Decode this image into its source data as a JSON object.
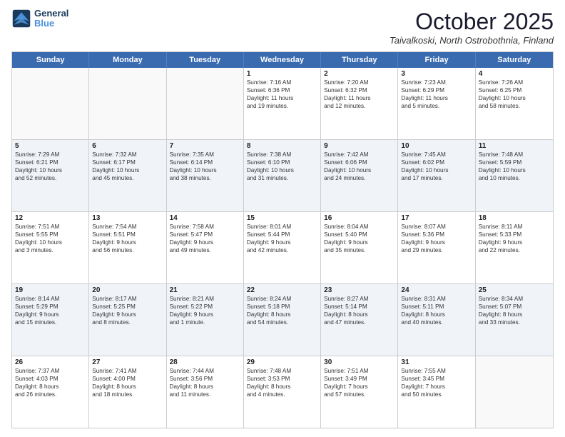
{
  "header": {
    "logo_line1": "General",
    "logo_line2": "Blue",
    "month": "October 2025",
    "location": "Taivalkoski, North Ostrobothnia, Finland"
  },
  "weekdays": [
    "Sunday",
    "Monday",
    "Tuesday",
    "Wednesday",
    "Thursday",
    "Friday",
    "Saturday"
  ],
  "rows": [
    [
      {
        "day": "",
        "info": "",
        "empty": true
      },
      {
        "day": "",
        "info": "",
        "empty": true
      },
      {
        "day": "",
        "info": "",
        "empty": true
      },
      {
        "day": "1",
        "info": "Sunrise: 7:16 AM\nSunset: 6:36 PM\nDaylight: 11 hours\nand 19 minutes.",
        "alt": false
      },
      {
        "day": "2",
        "info": "Sunrise: 7:20 AM\nSunset: 6:32 PM\nDaylight: 11 hours\nand 12 minutes.",
        "alt": false
      },
      {
        "day": "3",
        "info": "Sunrise: 7:23 AM\nSunset: 6:29 PM\nDaylight: 11 hours\nand 5 minutes.",
        "alt": false
      },
      {
        "day": "4",
        "info": "Sunrise: 7:26 AM\nSunset: 6:25 PM\nDaylight: 10 hours\nand 58 minutes.",
        "alt": false
      }
    ],
    [
      {
        "day": "5",
        "info": "Sunrise: 7:29 AM\nSunset: 6:21 PM\nDaylight: 10 hours\nand 52 minutes.",
        "alt": true
      },
      {
        "day": "6",
        "info": "Sunrise: 7:32 AM\nSunset: 6:17 PM\nDaylight: 10 hours\nand 45 minutes.",
        "alt": true
      },
      {
        "day": "7",
        "info": "Sunrise: 7:35 AM\nSunset: 6:14 PM\nDaylight: 10 hours\nand 38 minutes.",
        "alt": true
      },
      {
        "day": "8",
        "info": "Sunrise: 7:38 AM\nSunset: 6:10 PM\nDaylight: 10 hours\nand 31 minutes.",
        "alt": true
      },
      {
        "day": "9",
        "info": "Sunrise: 7:42 AM\nSunset: 6:06 PM\nDaylight: 10 hours\nand 24 minutes.",
        "alt": true
      },
      {
        "day": "10",
        "info": "Sunrise: 7:45 AM\nSunset: 6:02 PM\nDaylight: 10 hours\nand 17 minutes.",
        "alt": true
      },
      {
        "day": "11",
        "info": "Sunrise: 7:48 AM\nSunset: 5:59 PM\nDaylight: 10 hours\nand 10 minutes.",
        "alt": true
      }
    ],
    [
      {
        "day": "12",
        "info": "Sunrise: 7:51 AM\nSunset: 5:55 PM\nDaylight: 10 hours\nand 3 minutes.",
        "alt": false
      },
      {
        "day": "13",
        "info": "Sunrise: 7:54 AM\nSunset: 5:51 PM\nDaylight: 9 hours\nand 56 minutes.",
        "alt": false
      },
      {
        "day": "14",
        "info": "Sunrise: 7:58 AM\nSunset: 5:47 PM\nDaylight: 9 hours\nand 49 minutes.",
        "alt": false
      },
      {
        "day": "15",
        "info": "Sunrise: 8:01 AM\nSunset: 5:44 PM\nDaylight: 9 hours\nand 42 minutes.",
        "alt": false
      },
      {
        "day": "16",
        "info": "Sunrise: 8:04 AM\nSunset: 5:40 PM\nDaylight: 9 hours\nand 35 minutes.",
        "alt": false
      },
      {
        "day": "17",
        "info": "Sunrise: 8:07 AM\nSunset: 5:36 PM\nDaylight: 9 hours\nand 29 minutes.",
        "alt": false
      },
      {
        "day": "18",
        "info": "Sunrise: 8:11 AM\nSunset: 5:33 PM\nDaylight: 9 hours\nand 22 minutes.",
        "alt": false
      }
    ],
    [
      {
        "day": "19",
        "info": "Sunrise: 8:14 AM\nSunset: 5:29 PM\nDaylight: 9 hours\nand 15 minutes.",
        "alt": true
      },
      {
        "day": "20",
        "info": "Sunrise: 8:17 AM\nSunset: 5:25 PM\nDaylight: 9 hours\nand 8 minutes.",
        "alt": true
      },
      {
        "day": "21",
        "info": "Sunrise: 8:21 AM\nSunset: 5:22 PM\nDaylight: 9 hours\nand 1 minute.",
        "alt": true
      },
      {
        "day": "22",
        "info": "Sunrise: 8:24 AM\nSunset: 5:18 PM\nDaylight: 8 hours\nand 54 minutes.",
        "alt": true
      },
      {
        "day": "23",
        "info": "Sunrise: 8:27 AM\nSunset: 5:14 PM\nDaylight: 8 hours\nand 47 minutes.",
        "alt": true
      },
      {
        "day": "24",
        "info": "Sunrise: 8:31 AM\nSunset: 5:11 PM\nDaylight: 8 hours\nand 40 minutes.",
        "alt": true
      },
      {
        "day": "25",
        "info": "Sunrise: 8:34 AM\nSunset: 5:07 PM\nDaylight: 8 hours\nand 33 minutes.",
        "alt": true
      }
    ],
    [
      {
        "day": "26",
        "info": "Sunrise: 7:37 AM\nSunset: 4:03 PM\nDaylight: 8 hours\nand 26 minutes.",
        "alt": false
      },
      {
        "day": "27",
        "info": "Sunrise: 7:41 AM\nSunset: 4:00 PM\nDaylight: 8 hours\nand 18 minutes.",
        "alt": false
      },
      {
        "day": "28",
        "info": "Sunrise: 7:44 AM\nSunset: 3:56 PM\nDaylight: 8 hours\nand 11 minutes.",
        "alt": false
      },
      {
        "day": "29",
        "info": "Sunrise: 7:48 AM\nSunset: 3:53 PM\nDaylight: 8 hours\nand 4 minutes.",
        "alt": false
      },
      {
        "day": "30",
        "info": "Sunrise: 7:51 AM\nSunset: 3:49 PM\nDaylight: 7 hours\nand 57 minutes.",
        "alt": false
      },
      {
        "day": "31",
        "info": "Sunrise: 7:55 AM\nSunset: 3:45 PM\nDaylight: 7 hours\nand 50 minutes.",
        "alt": false
      },
      {
        "day": "",
        "info": "",
        "empty": true
      }
    ]
  ]
}
